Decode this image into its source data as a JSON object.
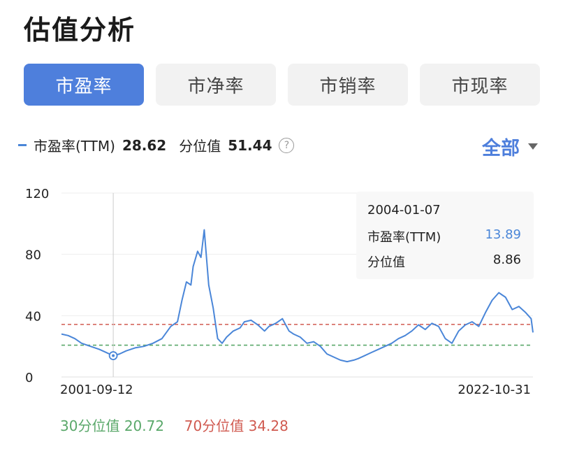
{
  "title": "估值分析",
  "tabs": [
    {
      "label": "市盈率",
      "active": true
    },
    {
      "label": "市净率",
      "active": false
    },
    {
      "label": "市销率",
      "active": false
    },
    {
      "label": "市现率",
      "active": false
    }
  ],
  "legend": {
    "series_label": "市盈率(TTM)",
    "series_value": "28.62",
    "percentile_label": "分位值",
    "percentile_value": "51.44",
    "help_icon": "question-circle-icon"
  },
  "range": {
    "label": "全部",
    "icon": "caret-down-icon"
  },
  "tooltip": {
    "date": "2004-01-07",
    "series_label": "市盈率(TTM)",
    "series_value": "13.89",
    "percentile_label": "分位值",
    "percentile_value": "8.86"
  },
  "thresholds": {
    "p30_label": "30分位值",
    "p30_value": "20.72",
    "p70_label": "70分位值",
    "p70_value": "34.28"
  },
  "colors": {
    "accent": "#4e7fdc",
    "line": "#4a86d8",
    "p30": "#5aa86a",
    "p70": "#d05a50"
  },
  "chart_data": {
    "type": "line",
    "series": [
      {
        "name": "市盈率(TTM)",
        "x": [
          2001.7,
          2002.0,
          2002.3,
          2002.6,
          2003.0,
          2003.4,
          2003.7,
          2004.02,
          2004.3,
          2004.6,
          2005.0,
          2005.4,
          2005.8,
          2006.2,
          2006.6,
          2006.9,
          2007.1,
          2007.3,
          2007.5,
          2007.6,
          2007.8,
          2007.95,
          2008.1,
          2008.3,
          2008.5,
          2008.7,
          2008.9,
          2009.1,
          2009.4,
          2009.7,
          2009.9,
          2010.2,
          2010.5,
          2010.8,
          2011.0,
          2011.3,
          2011.6,
          2011.9,
          2012.1,
          2012.4,
          2012.7,
          2013.0,
          2013.3,
          2013.6,
          2013.9,
          2014.2,
          2014.5,
          2014.8,
          2015.0,
          2015.3,
          2015.6,
          2015.9,
          2016.2,
          2016.5,
          2016.8,
          2017.1,
          2017.4,
          2017.7,
          2018.0,
          2018.3,
          2018.6,
          2018.9,
          2019.2,
          2019.5,
          2019.8,
          2020.1,
          2020.4,
          2020.7,
          2021.0,
          2021.3,
          2021.6,
          2021.9,
          2022.2,
          2022.5,
          2022.75,
          2022.83
        ],
        "values": [
          28,
          27,
          25,
          22,
          20,
          18,
          16,
          13.89,
          15,
          17,
          19,
          20,
          22,
          25,
          33,
          36,
          50,
          62,
          60,
          72,
          82,
          78,
          96,
          60,
          45,
          25,
          22,
          26,
          30,
          32,
          36,
          37,
          34,
          30,
          33,
          35,
          38,
          30,
          28,
          26,
          22,
          23,
          20,
          15,
          13,
          11,
          10,
          11,
          12,
          14,
          16,
          18,
          20,
          22,
          25,
          27,
          30,
          34,
          31,
          35,
          33,
          25,
          22,
          30,
          34,
          36,
          33,
          42,
          50,
          55,
          52,
          44,
          46,
          42,
          38,
          29
        ]
      }
    ],
    "xlim": [
      2001.7,
      2022.83
    ],
    "x_tick_labels": [
      "2001-09-12",
      "2022-10-31"
    ],
    "ylim": [
      0,
      120
    ],
    "yticks": [
      0,
      40,
      80,
      120
    ],
    "reference_lines": [
      {
        "name": "30分位值",
        "value": 20.72
      },
      {
        "name": "70分位值",
        "value": 34.28
      }
    ],
    "highlight": {
      "x": 2004.02,
      "value": 13.89
    },
    "grid": true,
    "legend_position": "top-left"
  }
}
